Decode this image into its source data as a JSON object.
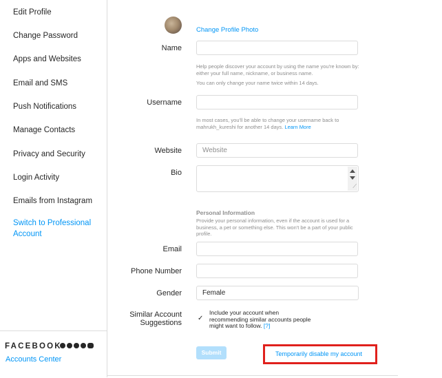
{
  "sidebar": {
    "items": [
      {
        "label": "Edit Profile"
      },
      {
        "label": "Change Password"
      },
      {
        "label": "Apps and Websites"
      },
      {
        "label": "Email and SMS"
      },
      {
        "label": "Push Notifications"
      },
      {
        "label": "Manage Contacts"
      },
      {
        "label": "Privacy and Security"
      },
      {
        "label": "Login Activity"
      },
      {
        "label": "Emails from Instagram"
      }
    ],
    "pro_line1": "Switch to Professional",
    "pro_line2": "Account",
    "facebook_logo": "FACEBOOK",
    "accounts_center": "Accounts Center"
  },
  "profile": {
    "change_photo": "Change Profile Photo"
  },
  "form": {
    "name_label": "Name",
    "name_value": "",
    "name_help1": "Help people discover your account by using the name you're known by: either your full name, nickname, or business name.",
    "name_help2": "You can only change your name twice within 14 days.",
    "username_label": "Username",
    "username_value": "",
    "username_help": "In most cases, you'll be able to change your username back to mahrukh_kureshi for another 14 days.",
    "learn_more": "Learn More",
    "website_label": "Website",
    "website_placeholder": "Website",
    "bio_label": "Bio",
    "personal_info_title": "Personal Information",
    "personal_info_help": "Provide your personal information, even if the account is used for a business, a pet or something else. This won't be a part of your public profile.",
    "email_label": "Email",
    "email_value": "",
    "phone_label": "Phone Number",
    "phone_value": "",
    "gender_label": "Gender",
    "gender_value": "Female",
    "similar_label_line1": "Similar Account",
    "similar_label_line2": "Suggestions",
    "similar_check_text": "Include your account when recommending similar accounts people might want to follow.",
    "similar_help_link": "[?]",
    "submit_label": "Submit",
    "disable_label": "Temporarily disable my account"
  },
  "colors": {
    "accent": "#0095f6",
    "highlight_box": "#e0201c",
    "submit_disabled": "#b2dffc"
  }
}
